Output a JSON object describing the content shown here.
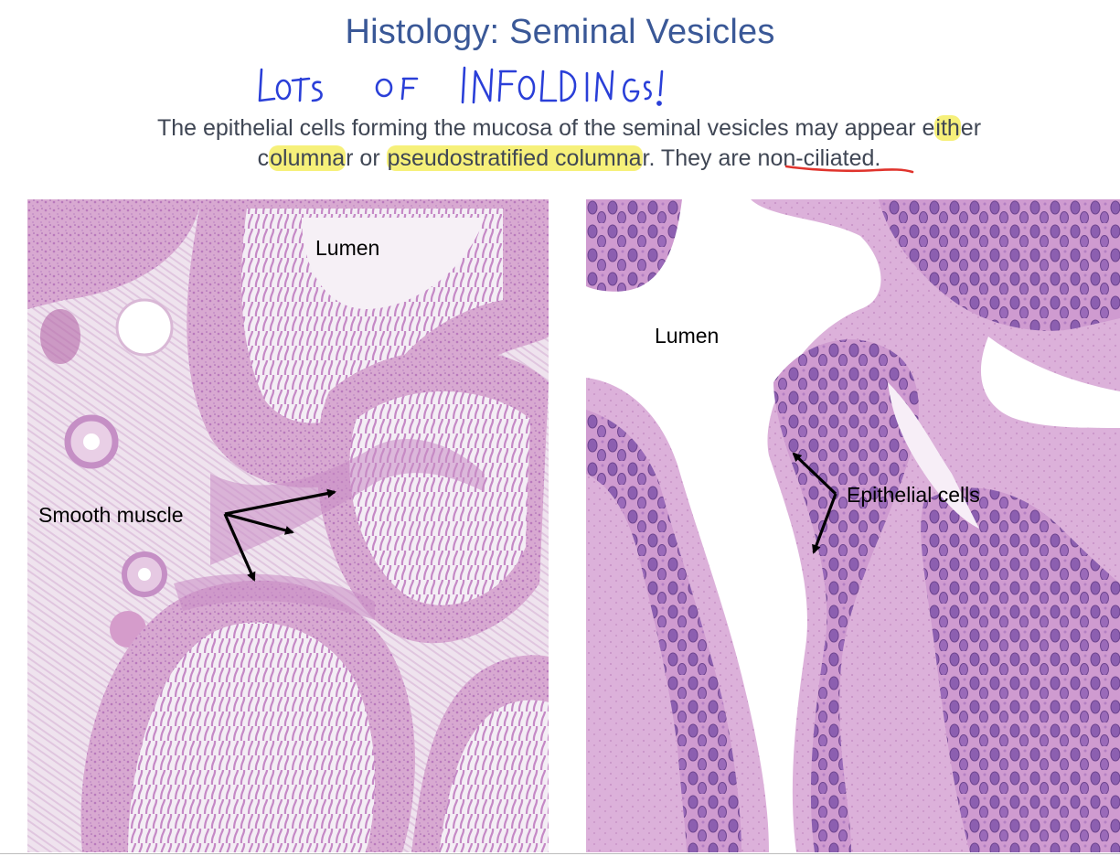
{
  "slide": {
    "title": "Histology: Seminal Vesicles",
    "handwritten_note": "LOTS OF INFOLDINGS!",
    "body": {
      "line1_before": "The epithelial cells forming the mucosa of the seminal vesicles may appear e",
      "line1_highlight": "ith",
      "line1_after": "er",
      "line2_part1": "c",
      "line2_highlight1": "olumna",
      "line2_part2": "r or ",
      "line2_highlight2": "pseudostratified columna",
      "line2_part3": "r. They are non-ciliated."
    },
    "left_image": {
      "label_lumen": "Lumen",
      "label_muscle": "Smooth muscle"
    },
    "right_image": {
      "label_lumen": "Lumen",
      "label_epithelial": "Epithelial cells"
    },
    "colors": {
      "title": "#3a5897",
      "handwriting": "#2a3fd8",
      "highlight": "#f6f07a",
      "underline": "#e0332c",
      "stain_pink": "#d79fcc",
      "stain_purple": "#a46bb4"
    }
  }
}
